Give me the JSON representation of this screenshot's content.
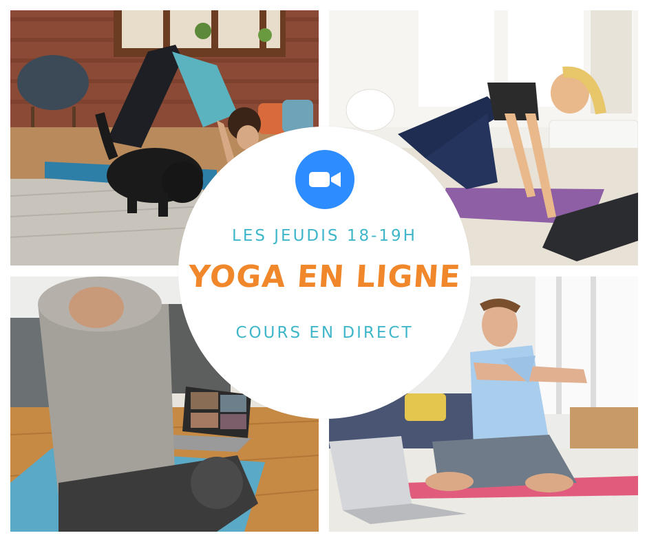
{
  "poster": {
    "schedule": "LES JEUDIS 18-19H",
    "headline": "YOGA EN LIGNE",
    "subline": "COURS EN DIRECT"
  },
  "badge": {
    "icon": "video-camera-icon",
    "color": "#2d8cff"
  },
  "colors": {
    "schedule_text": "#3fb6c9",
    "headline_text": "#f0882b",
    "circle_fill": "#ffffff"
  },
  "photos": [
    {
      "name": "photo-woman-downward-dog-with-dog"
    },
    {
      "name": "photo-woman-kneeling-plank-laptop"
    },
    {
      "name": "photo-person-stretching-video-call"
    },
    {
      "name": "photo-man-seated-arm-stretch"
    }
  ]
}
